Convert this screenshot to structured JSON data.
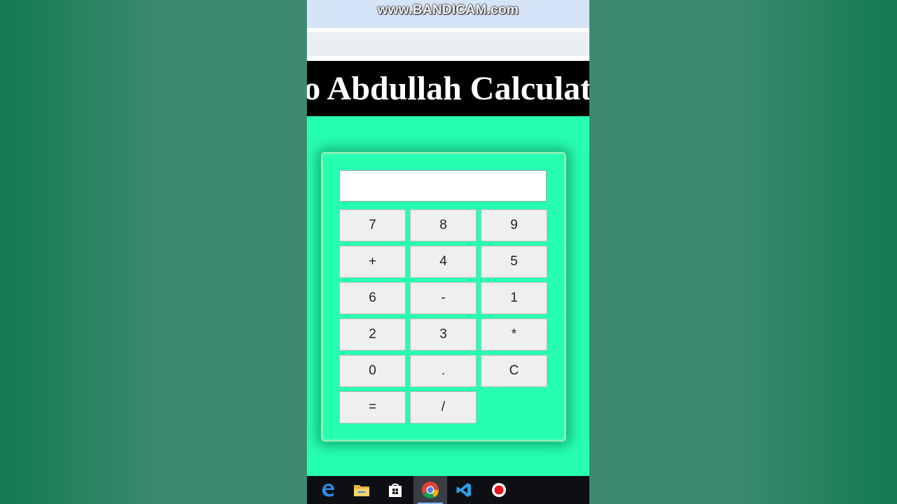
{
  "watermark": "www.BANDICAM.com",
  "banner": {
    "title": "Welcome To Abdullah Calculator"
  },
  "calculator": {
    "display_value": "",
    "keys": [
      "7",
      "8",
      "9",
      "+",
      "4",
      "5",
      "6",
      "-",
      "1",
      "2",
      "3",
      "*",
      "0",
      ".",
      "C",
      "=",
      "/"
    ]
  },
  "taskbar": {
    "icons": [
      "edge-icon",
      "file-explorer-icon",
      "microsoft-store-icon",
      "chrome-icon",
      "vscode-icon",
      "bandicam-record-icon"
    ],
    "active": "chrome-icon"
  },
  "colors": {
    "page_background": "#27ffb0",
    "banner_background": "#000000",
    "calculator_border": "#89f0b4",
    "key_background": "#efefef"
  }
}
